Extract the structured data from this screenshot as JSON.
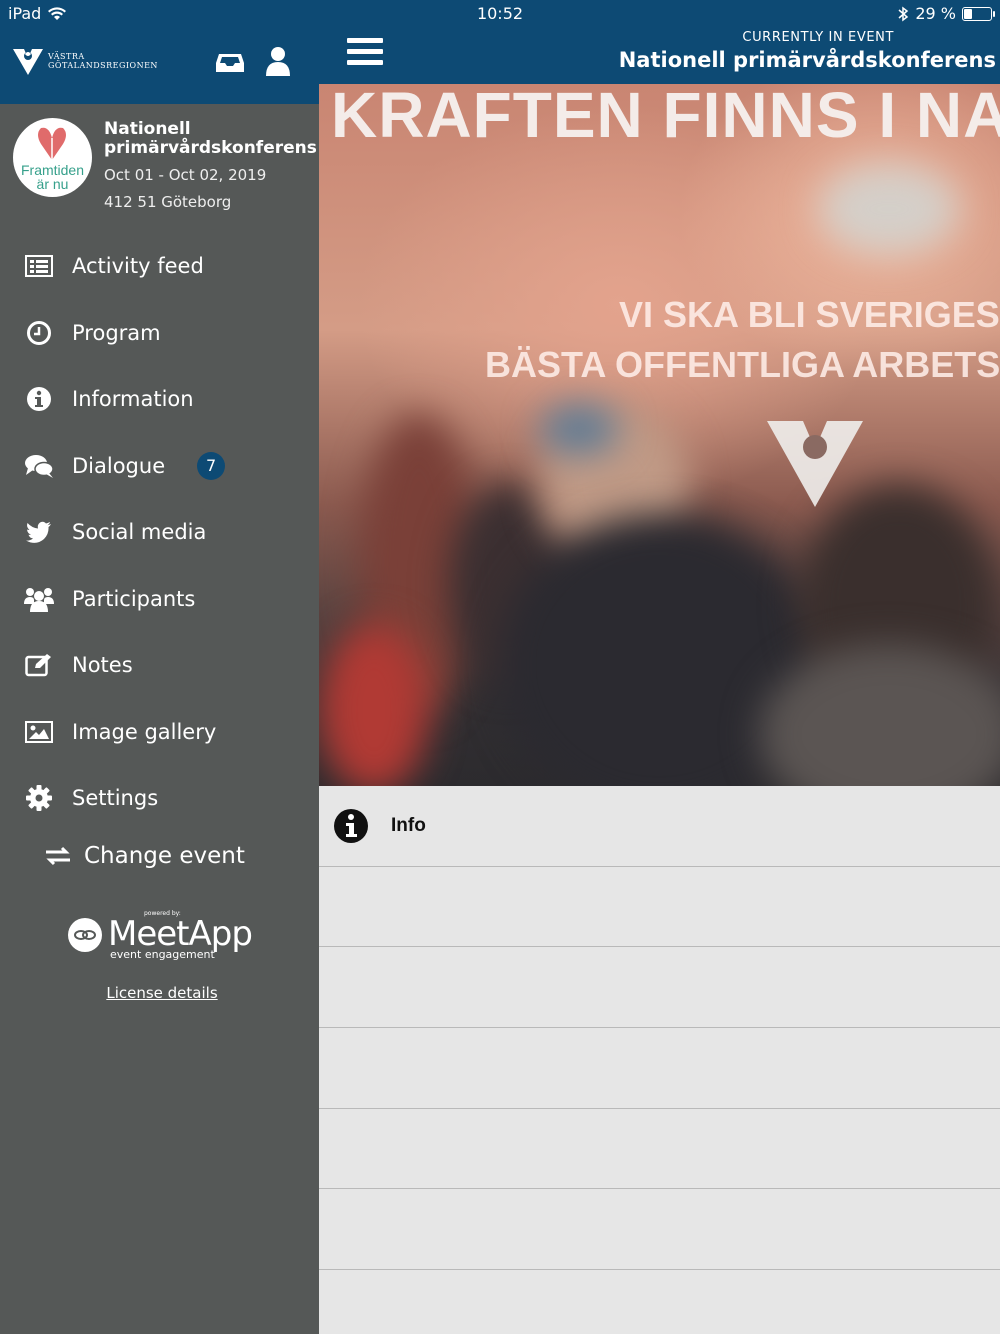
{
  "status_bar": {
    "device": "iPad",
    "time": "10:52",
    "battery_text": "29 %",
    "battery_level": 0.29
  },
  "sidebar": {
    "org_name_line1": "VÄSTRA",
    "org_name_line2": "GÖTALANDSREGIONEN",
    "event": {
      "logo_text_1": "Framtiden",
      "logo_text_2": "är nu",
      "name": "Nationell primärvårdskonferens",
      "dates": "Oct 01 - Oct 02, 2019",
      "location": "412 51  Göteborg"
    },
    "menu": [
      {
        "label": "Activity feed",
        "icon": "activity-feed-icon"
      },
      {
        "label": "Program",
        "icon": "clock-icon"
      },
      {
        "label": "Information",
        "icon": "info-icon"
      },
      {
        "label": "Dialogue",
        "icon": "chat-bubbles-icon",
        "badge": "7"
      },
      {
        "label": "Social media",
        "icon": "twitter-icon"
      },
      {
        "label": "Participants",
        "icon": "people-icon"
      },
      {
        "label": "Notes",
        "icon": "edit-note-icon"
      },
      {
        "label": "Image gallery",
        "icon": "image-icon"
      },
      {
        "label": "Settings",
        "icon": "gear-icon"
      }
    ],
    "change_event_label": "Change event",
    "powered_by": "powered by:",
    "brand_name": "MeetApp",
    "brand_tagline": "event engagement",
    "license_label": "License details"
  },
  "topbar": {
    "current_label": "CURRENTLY IN EVENT",
    "current_event": "Nationell primärvårdskonferens"
  },
  "hero": {
    "headline": "KRAFTEN FINNS I NA",
    "line1": "VI SKA BLI SVERIGES",
    "line2": "BÄSTA OFFENTLIGA ARBETS"
  },
  "list": {
    "rows": [
      {
        "label": "Info",
        "icon": "info-icon"
      },
      {
        "label": ""
      },
      {
        "label": ""
      },
      {
        "label": ""
      },
      {
        "label": ""
      },
      {
        "label": ""
      },
      {
        "label": ""
      }
    ]
  },
  "colors": {
    "header_blue": "#0d4a74",
    "sidebar_gray": "#555857",
    "list_bg": "#e6e6e6"
  }
}
